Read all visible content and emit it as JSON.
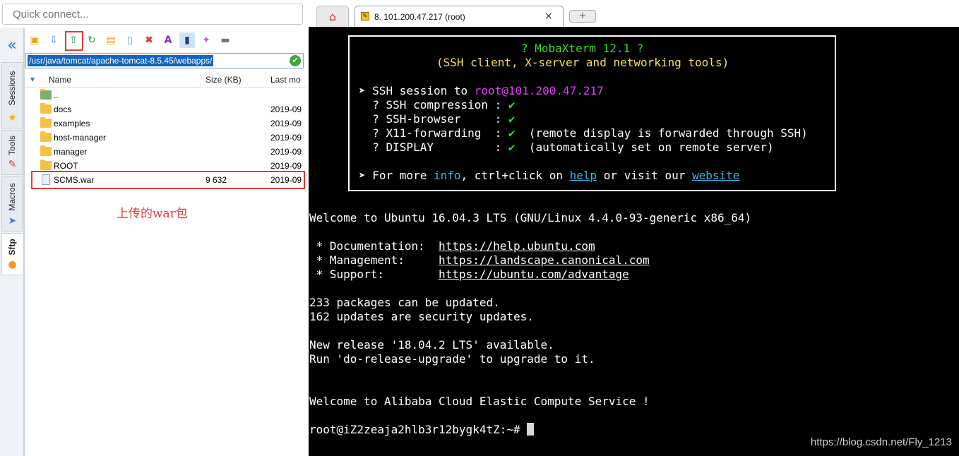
{
  "quick_connect": {
    "placeholder": "Quick connect..."
  },
  "side_tabs": [
    {
      "label": "Sessions",
      "icon": "star-icon"
    },
    {
      "label": "Tools",
      "icon": "tools-icon"
    },
    {
      "label": "Macros",
      "icon": "macro-icon"
    },
    {
      "label": "Sftp",
      "icon": "sftp-icon"
    }
  ],
  "sftp": {
    "path": "/usr/java/tomcat/apache-tomcat-8.5.45/webapps/",
    "columns": {
      "name": "Name",
      "size": "Size (KB)",
      "modified": "Last mo"
    },
    "rows": [
      {
        "name": "..",
        "size": "",
        "date": ""
      },
      {
        "name": "docs",
        "size": "",
        "date": "2019-09"
      },
      {
        "name": "examples",
        "size": "",
        "date": "2019-09"
      },
      {
        "name": "host-manager",
        "size": "",
        "date": "2019-09"
      },
      {
        "name": "manager",
        "size": "",
        "date": "2019-09"
      },
      {
        "name": "ROOT",
        "size": "",
        "date": "2019-09"
      },
      {
        "name": "SCMS.war",
        "size": "9 632",
        "date": "2019-09"
      }
    ],
    "annotation": "上传的war包"
  },
  "tabs": {
    "session_title": "8. 101.200.47.217 (root)",
    "close": "×",
    "new_tab": "+"
  },
  "terminal": {
    "banner_title": "? MobaXterm 12.1 ?",
    "banner_subtitle": "(SSH client, X-server and networking tools)",
    "ssh_prefix": "➤ SSH session to ",
    "ssh_user": "root",
    "ssh_host": "@101.200.47.217",
    "features": [
      {
        "label": "  ? SSH compression : ",
        "check": "✔",
        "note": ""
      },
      {
        "label": "  ? SSH-browser     : ",
        "check": "✔",
        "note": ""
      },
      {
        "label": "  ? X11-forwarding  : ",
        "check": "✔",
        "note": "  (remote display is forwarded through SSH)"
      },
      {
        "label": "  ? DISPLAY         : ",
        "check": "✔",
        "note": "  (automatically set on remote server)"
      }
    ],
    "more_prefix": "➤ For more ",
    "more_info": "info",
    "more_mid": ", ctrl+click on ",
    "more_help": "help",
    "more_mid2": " or visit our ",
    "more_website": "website",
    "welcome": "Welcome to Ubuntu 16.04.3 LTS (GNU/Linux 4.4.0-93-generic x86_64)",
    "doc_label": " * Documentation:  ",
    "doc_url": "https://help.ubuntu.com",
    "mgmt_label": " * Management:     ",
    "mgmt_url": "https://landscape.canonical.com",
    "support_label": " * Support:        ",
    "support_url": "https://ubuntu.com/advantage",
    "packages": "233 packages can be updated.",
    "security": "162 updates are security updates.",
    "release": "New release '18.04.2 LTS' available.",
    "upgrade": "Run 'do-release-upgrade' to upgrade to it.",
    "alibaba": "Welcome to Alibaba Cloud Elastic Compute Service !",
    "prompt": "root@iZ2zeaja2hlb3r12bygk4tZ:~# "
  },
  "watermark": "https://blog.csdn.net/Fly_1213"
}
